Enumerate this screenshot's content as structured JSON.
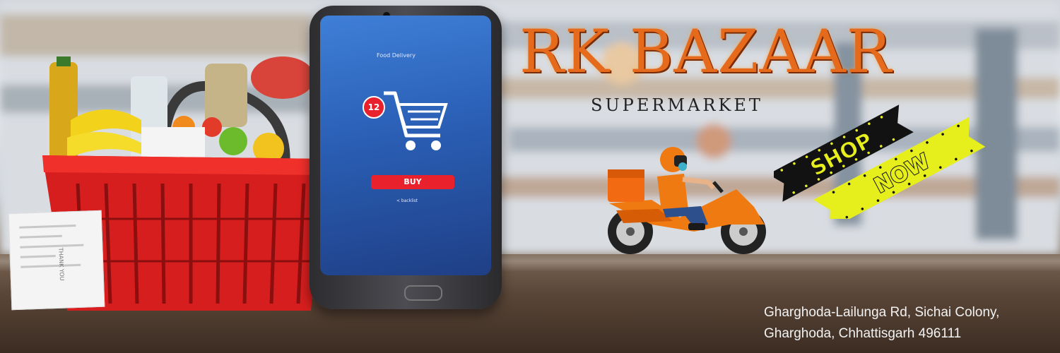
{
  "banner": {
    "brand_name": "RK BAZAAR",
    "tagline": "SUPERMARKET",
    "cta": {
      "line1": "SHOP",
      "line2": "NOW"
    },
    "address": {
      "line1": "Gharghoda-Lailunga Rd, Sichai Colony,",
      "line2": "Gharghoda, Chhattisgarh 496111"
    }
  },
  "phone_screen": {
    "app_title": "Food Delivery",
    "cart_count": "12",
    "buy_label": "BUY",
    "back_label": "< backlist"
  },
  "receipt": {
    "text": "THANK YOU"
  },
  "colors": {
    "brand_orange": "#e56a1c",
    "buy_red": "#e8212d",
    "ribbon_black": "#121212",
    "ribbon_yellow": "#e6ee1c",
    "screen_blue": "#2a5fb5"
  },
  "icons": [
    "shopping-cart-icon",
    "grocery-basket-icon",
    "delivery-scooter-icon"
  ]
}
